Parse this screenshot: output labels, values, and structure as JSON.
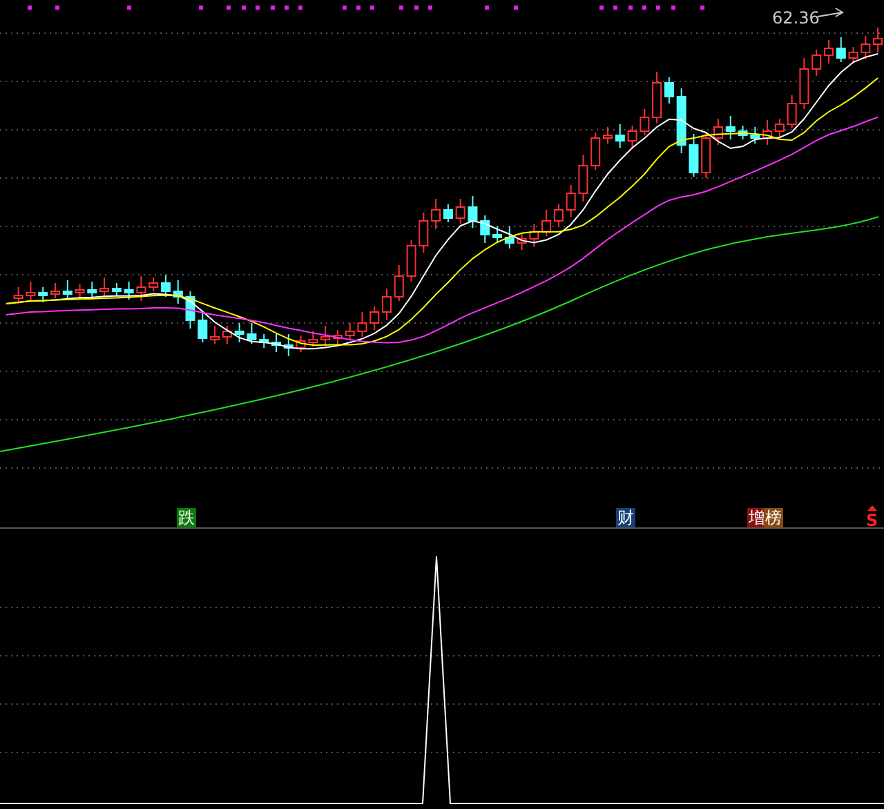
{
  "price_panel": {
    "high_marker": "62.36",
    "signals": [
      {
        "label": "跌",
        "color": "#0a7a0a"
      },
      {
        "label": "财",
        "color": "#173f78"
      },
      {
        "label": "增",
        "color": "#8a1010"
      },
      {
        "label": "榜",
        "color": "#8a4a12"
      }
    ],
    "sell_mark": "S"
  }
}
